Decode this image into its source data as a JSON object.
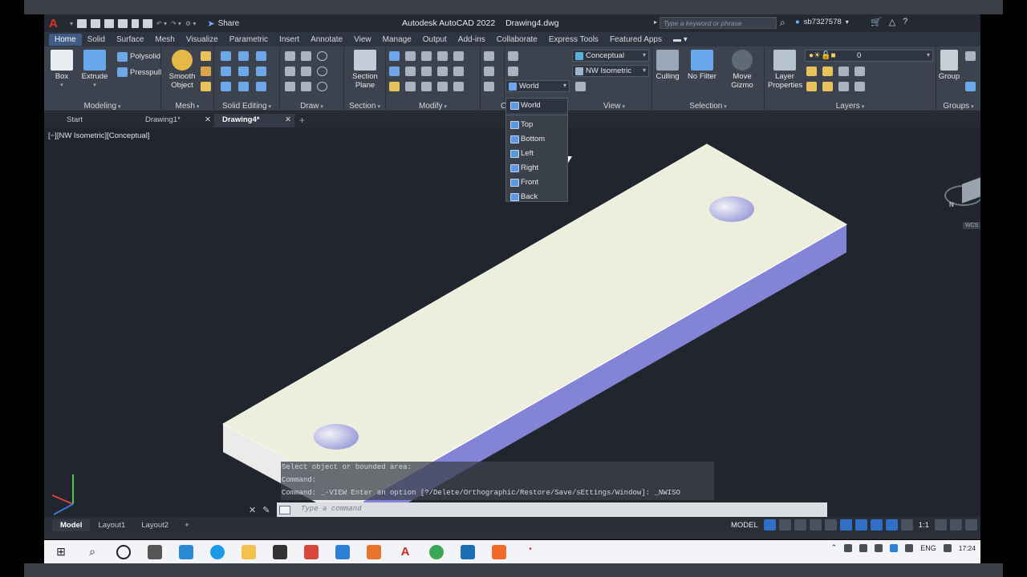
{
  "titlebar": {
    "share_label": "Share",
    "app_title": "Autodesk AutoCAD 2022",
    "file_name": "Drawing4.dwg",
    "search_placeholder": "Type a keyword or phrase",
    "username": "sb7327578"
  },
  "ribbon_tabs": [
    "Home",
    "Solid",
    "Surface",
    "Mesh",
    "Visualize",
    "Parametric",
    "Insert",
    "Annotate",
    "View",
    "Manage",
    "Output",
    "Add-ins",
    "Collaborate",
    "Express Tools",
    "Featured Apps"
  ],
  "ribbon": {
    "modeling": {
      "title": "Modeling",
      "box": "Box",
      "extrude": "Extrude",
      "polysolid": "Polysolid",
      "presspull": "Presspull"
    },
    "mesh": {
      "title": "Mesh",
      "smooth_object": "Smooth Object"
    },
    "solid_editing": {
      "title": "Solid Editing"
    },
    "draw": {
      "title": "Draw"
    },
    "section": {
      "title": "Section",
      "section_plane": "Section Plane"
    },
    "modify": {
      "title": "Modify"
    },
    "coordinates_clip": "C",
    "view": {
      "title": "View",
      "visual_style": "Conceptual",
      "view_name": "NW Isometric",
      "ucs": "World"
    },
    "selection": {
      "title": "Selection",
      "culling": "Culling",
      "no_filter": "No Filter",
      "move_gizmo": "Move Gizmo"
    },
    "layers": {
      "title": "Layers",
      "layer_properties": "Layer Properties",
      "current_layer": "0"
    },
    "groups": {
      "title": "Groups",
      "group": "Group"
    }
  },
  "file_tabs": [
    {
      "label": "Start"
    },
    {
      "label": "Drawing1*"
    },
    {
      "label": "Drawing4*"
    }
  ],
  "viewport": {
    "label": "[−][NW Isometric][Conceptual]",
    "viewcube_north": "N",
    "wcs": "WCS"
  },
  "ucs_dropdown": {
    "items": [
      "World",
      "Top",
      "Bottom",
      "Left",
      "Right",
      "Front",
      "Back"
    ]
  },
  "command": {
    "history": [
      "Select object or bounded area:",
      "Command:",
      "Command: _-VIEW Enter an option [?/Delete/Orthographic/Restore/Save/sEttings/Window]: _NWISO"
    ],
    "placeholder": "Type a command"
  },
  "layout_tabs": [
    "Model",
    "Layout1",
    "Layout2"
  ],
  "status": {
    "model": "MODEL",
    "scale": "1:1"
  },
  "taskbar": {
    "lang": "ENG",
    "time": "17:24"
  },
  "colors": {
    "accent": "#2f6fc7",
    "top_face": "#eeeedd",
    "side_face": "#8484d6",
    "autocad_red": "#e0332b"
  }
}
